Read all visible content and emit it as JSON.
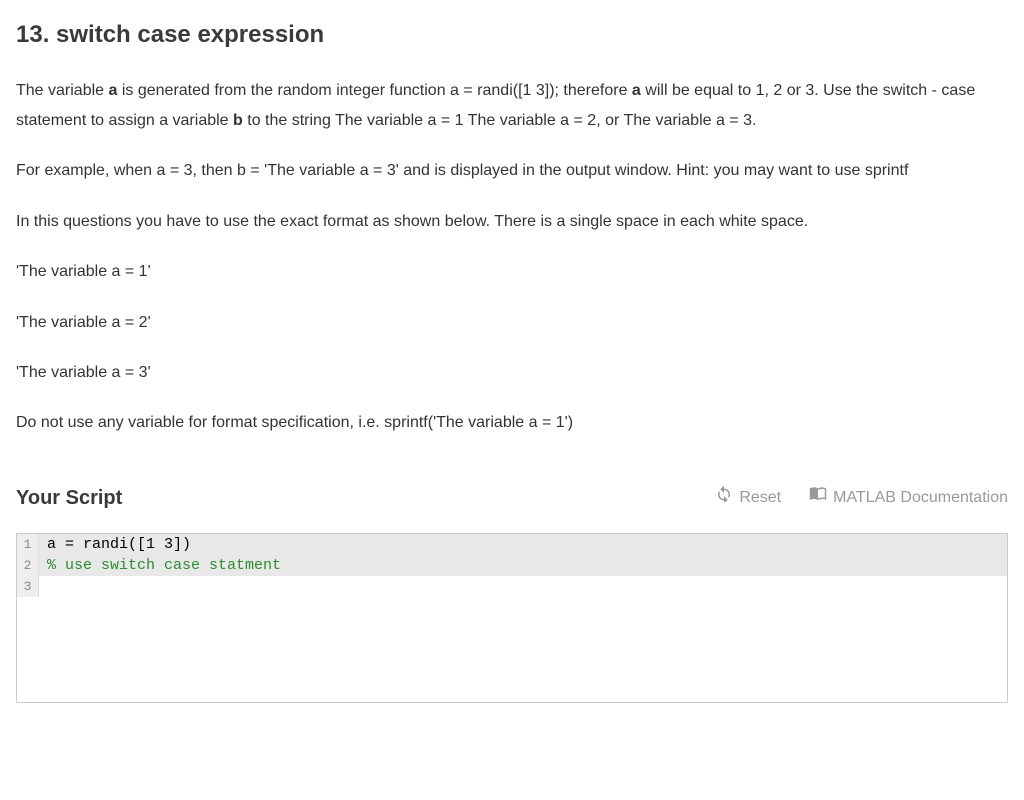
{
  "title": "13. switch case expression",
  "para1_part1": "The variable ",
  "para1_bold1": "a",
  "para1_part2": " is generated from the random integer function a = randi([1 3]); therefore ",
  "para1_bold2": "a",
  "para1_part3": " will be equal to 1, 2 or 3.  Use the switch - case statement to assign a variable ",
  "para1_bold3": "b",
  "para1_part4": " to the string  The variable a = 1  The variable a = 2, or The variable a = 3.",
  "para2": "For example, when a = 3, then b = 'The variable a = 3' and is displayed in the output window.  Hint:  you may want to use sprintf",
  "para3": "In this questions you have to use the exact format as shown below.  There is a single space in each white space.",
  "example1": "'The variable a = 1'",
  "example2": "'The variable a = 2'",
  "example3": "'The variable a = 3'",
  "para4": "Do not use any variable for format specification, i.e. sprintf('The variable a = 1')",
  "script_label": "Your Script",
  "reset_label": "Reset",
  "doc_label": "MATLAB Documentation",
  "code": {
    "lines": [
      {
        "num": "1",
        "content": "a = randi([1 3])",
        "type": "code",
        "highlighted": true
      },
      {
        "num": "2",
        "content": "% use switch case statment",
        "type": "comment",
        "highlighted": true
      },
      {
        "num": "3",
        "content": "",
        "type": "code",
        "highlighted": false
      }
    ]
  }
}
